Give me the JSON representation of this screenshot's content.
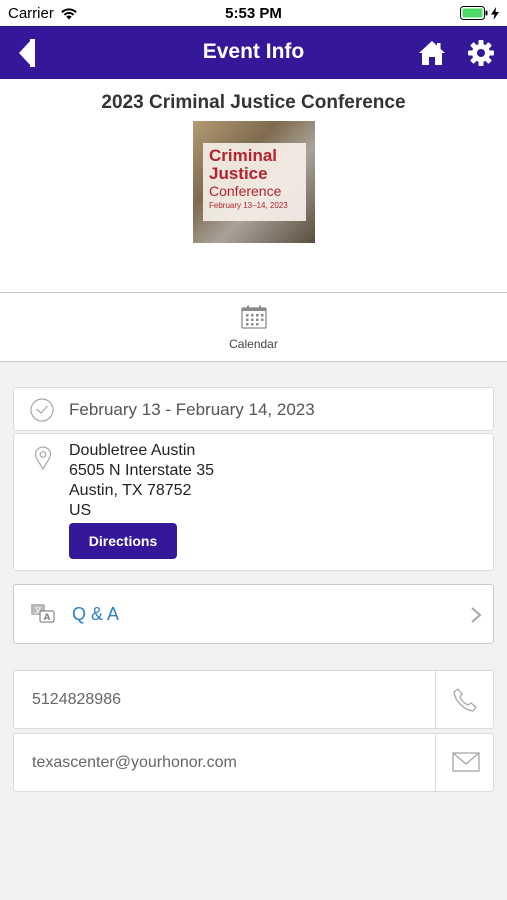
{
  "status_bar": {
    "carrier": "Carrier",
    "time": "5:53 PM"
  },
  "navbar": {
    "title": "Event Info",
    "icons": [
      "back-arrow-icon",
      "home-icon",
      "gear-icon"
    ]
  },
  "event": {
    "title": "2023 Criminal Justice Conference",
    "poster": {
      "line1": "Criminal",
      "line2": "Justice",
      "line3": "Conference",
      "dates": "February 13–14, 2023"
    }
  },
  "tabs": {
    "calendar_label": "Calendar"
  },
  "details": {
    "date_range": "February 13 - February 14, 2023",
    "venue": "Doubletree Austin",
    "street": "6505 N Interstate 35",
    "city_line": "Austin, TX 78752",
    "country": "US",
    "directions_label": "Directions"
  },
  "qa": {
    "label": "Q & A"
  },
  "contact": {
    "phone": "5124828986",
    "email": "texascenter@yourhonor.com"
  },
  "colors": {
    "brand": "#35189a",
    "link": "#2b7fc8",
    "background": "#f2f2f4"
  }
}
